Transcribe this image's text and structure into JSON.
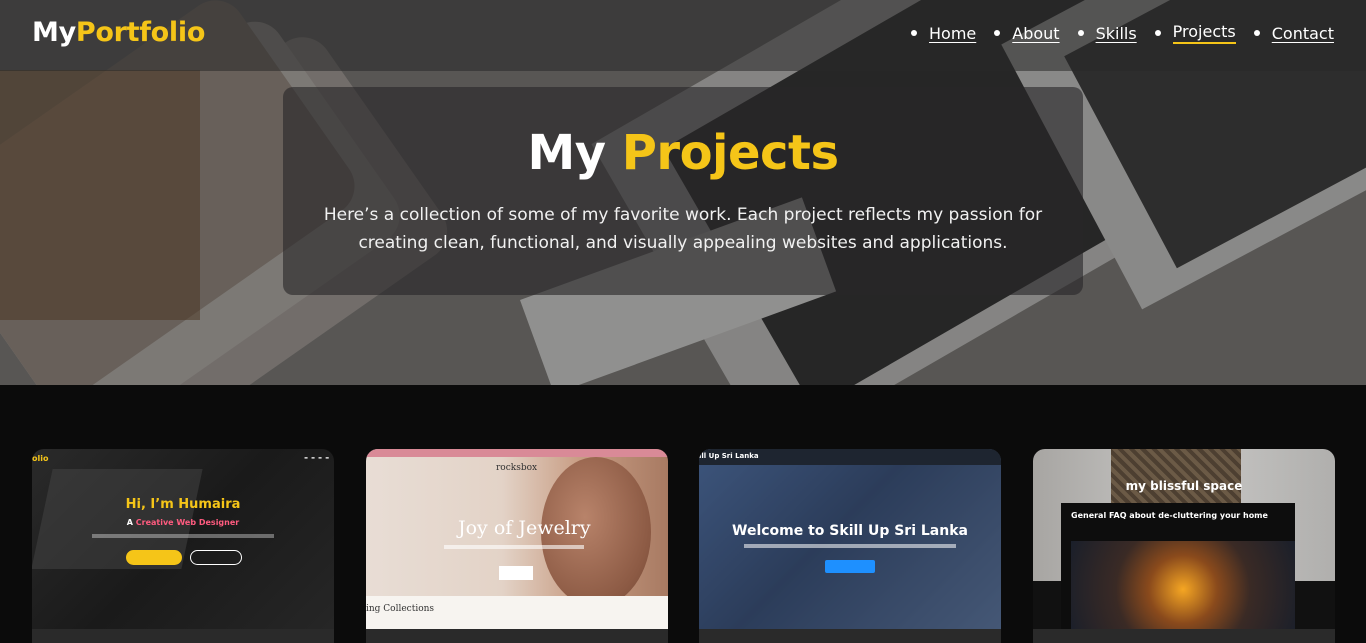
{
  "nav": {
    "logo_main": "My",
    "logo_accent": "Portfolio",
    "links": [
      "Home",
      "About",
      "Skills",
      "Projects",
      "Contact"
    ],
    "active": "Projects"
  },
  "hero": {
    "title_main": "My ",
    "title_accent": "Projects",
    "description": "Here’s a collection of some of my favorite work. Each project reflects my passion for creating clean, functional, and visually appealing websites and applications."
  },
  "projects": [
    {
      "logo": "olio",
      "heading_prefix": "Hi, I’m ",
      "heading_name": "Humaira",
      "subheading_prefix": "A ",
      "subheading_role": "Creative Web Designer"
    },
    {
      "brand": "rocksbox",
      "title": "Joy of Jewelry",
      "bottom_text": "ing Collections"
    },
    {
      "topbar": "ill Up Sri Lanka",
      "heading": "Welcome to Skill Up Sri Lanka"
    },
    {
      "heading": "my blissful space",
      "panel_title": "General FAQ about de-cluttering your home"
    }
  ],
  "colors": {
    "accent": "#f5c518",
    "background": "#0b0b0b"
  }
}
